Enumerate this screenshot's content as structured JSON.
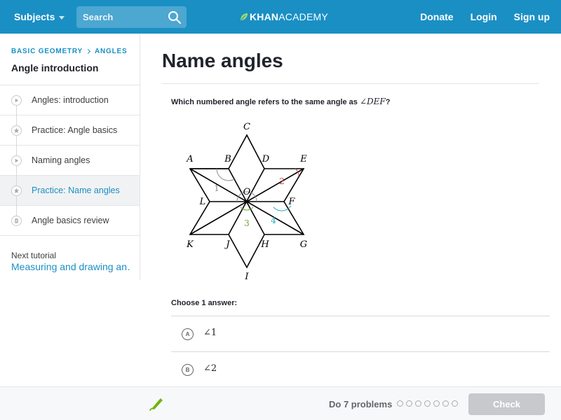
{
  "header": {
    "subjects_label": "Subjects",
    "search_placeholder": "Search",
    "logo_bold": "KHAN",
    "logo_light": "ACADEMY",
    "donate": "Donate",
    "login": "Login",
    "signup": "Sign up"
  },
  "sidebar": {
    "crumb_1": "BASIC GEOMETRY",
    "crumb_2": "ANGLES",
    "unit_title": "Angle introduction",
    "items": [
      {
        "label": "Angles: introduction",
        "icon": "play-icon"
      },
      {
        "label": "Practice: Angle basics",
        "icon": "star-icon"
      },
      {
        "label": "Naming angles",
        "icon": "play-icon"
      },
      {
        "label": "Practice: Name angles",
        "icon": "star-icon",
        "active": true
      },
      {
        "label": "Angle basics review",
        "icon": "document-icon"
      }
    ],
    "next_label": "Next tutorial",
    "next_link": "Measuring and drawing an…"
  },
  "main": {
    "title": "Name angles",
    "question_prefix": "Which numbered angle refers to the same angle as ",
    "question_math": "∠DEF",
    "question_suffix": "?",
    "figure": {
      "point_labels": [
        "A",
        "B",
        "C",
        "D",
        "E",
        "F",
        "G",
        "H",
        "I",
        "J",
        "K",
        "L",
        "O"
      ],
      "angle_labels": [
        "1",
        "2",
        "3",
        "4"
      ]
    },
    "choose_label": "Choose 1 answer:",
    "choices": [
      {
        "letter": "A",
        "text": "∠1"
      },
      {
        "letter": "B",
        "text": "∠2"
      }
    ]
  },
  "footer": {
    "progress_text": "Do 7 problems",
    "problem_count": 7,
    "check_label": "Check"
  },
  "colors": {
    "header": "#1a8fc4",
    "link": "#1a8fc4",
    "angle_1": "#8c8c8c",
    "angle_2": "#d04a4a",
    "angle_3": "#6da831",
    "angle_4": "#1ea8c4"
  }
}
